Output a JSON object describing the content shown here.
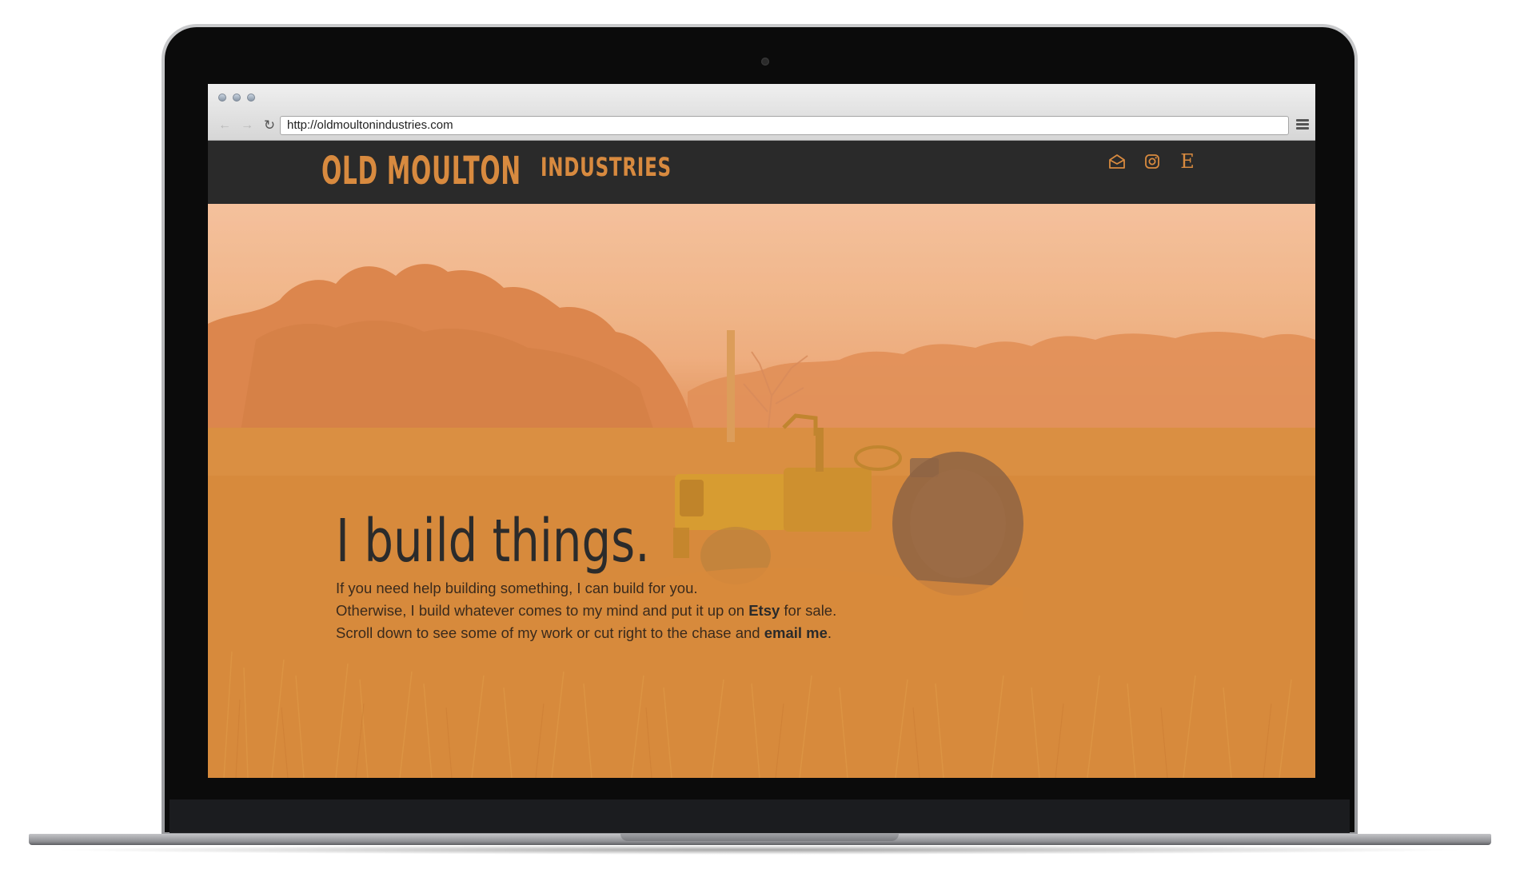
{
  "browser": {
    "url": "http://oldmoultonindustries.com",
    "back_glyph": "←",
    "forward_glyph": "→",
    "reload_glyph": "↻"
  },
  "site": {
    "logo_main": "OLD MOULTON",
    "logo_sub": "INDUSTRIES",
    "icons": [
      "email-icon",
      "instagram-icon",
      "etsy-icon"
    ],
    "etsy_glyph": "E"
  },
  "hero": {
    "title": "I build things.",
    "line1": "If you need help building something, I can build for you.",
    "line2_pre": "Otherwise, I build whatever comes to my mind and put it up on ",
    "line2_link": "Etsy",
    "line2_post": " for sale.",
    "line3_pre": "Scroll down to see some of my work or cut right to the chase and ",
    "line3_link": "email me",
    "line3_post": "."
  },
  "colors": {
    "accent": "#d88a3f",
    "header_bg": "#2a2a2a",
    "hero_tint": "#e39151",
    "text_dark": "#2b2b2b"
  }
}
